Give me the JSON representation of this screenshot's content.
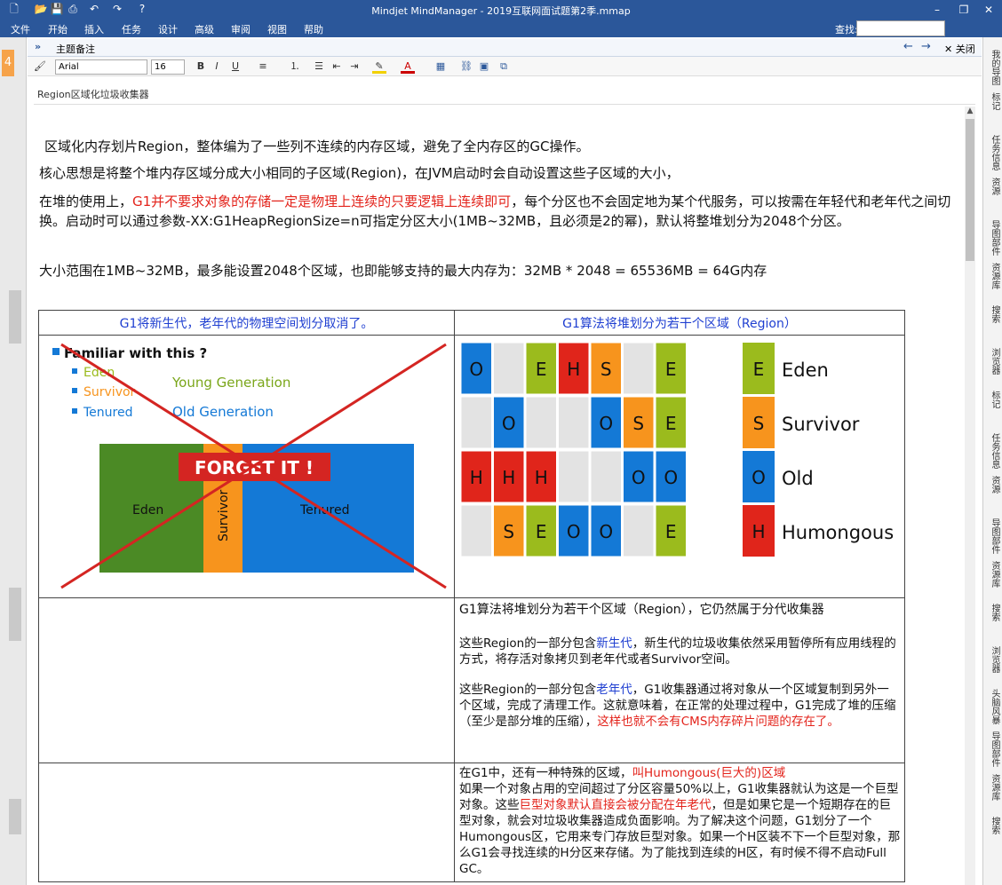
{
  "app": {
    "window_title": "Mindjet MindManager - 2019互联网面试题第2季.mmap",
    "menus": [
      "文件",
      "开始",
      "插入",
      "任务",
      "设计",
      "高级",
      "审阅",
      "视图",
      "帮助"
    ],
    "find_label": "查找:",
    "find_value": ""
  },
  "note_panel": {
    "title": "主题备注",
    "close_label": "✕ 关闭",
    "font_name": "Arial",
    "font_size": "16",
    "bold": "B",
    "italic": "I",
    "underline": "U"
  },
  "right_sidebar": [
    "我的导图",
    "标记",
    "任务信息",
    "资源",
    "导图部件",
    "资源库",
    "搜索",
    "浏览器",
    "标记",
    "任务信息",
    "资源",
    "导图部件",
    "资源库",
    "搜索",
    "浏览器",
    "头脑风暴",
    "导图部件",
    "资源库",
    "搜索"
  ],
  "left_strip_number": "4",
  "topic": "Region区域化垃圾收集器",
  "paragraphs": {
    "p1": "区域化内存划片Region，整体编为了一些列不连续的内存区域，避免了全内存区的GC操作。",
    "p2": "核心思想是将整个堆内存区域分成大小相同的子区域(Region)，在JVM启动时会自动设置这些子区域的大小，",
    "p3_a": "在堆的使用上，",
    "p3_red": "G1并不要求对象的存储一定是物理上连续的只要逻辑上连续即可",
    "p3_b": "，每个分区也不会固定地为某个代服务，可以按需在年轻代和老年代之间切换。启动时可以通过参数-XX:G1HeapRegionSize=n可指定分区大小(1MB~32MB，且必须是2的幂)，默认将整堆划分为2048个分区。",
    "p4": "大小范围在1MB~32MB，最多能设置2048个区域，也即能够支持的最大内存为：32MB * 2048 = 65536MB = 64G内存"
  },
  "table": {
    "header_left": "G1将新生代，老年代的物理空间划分取消了。",
    "header_right": "G1算法将堆划分为若干个区域（Region）",
    "left_image": {
      "heading": "Familiar with this ?",
      "items": [
        "Eden",
        "Survivor",
        "Tenured"
      ],
      "young": "Young Generation",
      "old": "Old Generation",
      "banner": "FORGET IT !",
      "bar_eden": "Eden",
      "bar_survivor": "Survivor",
      "bar_tenured": "Tenured"
    },
    "grid_letters": [
      [
        "O",
        "",
        "E",
        "H",
        "S",
        "",
        "E"
      ],
      [
        "",
        "O",
        "",
        "",
        "O",
        "S",
        "E"
      ],
      [
        "H",
        "H",
        "H",
        "",
        "",
        "O",
        "O"
      ],
      [
        "",
        "S",
        "E",
        "O",
        "O",
        "",
        "E"
      ]
    ],
    "legend": [
      {
        "letter": "E",
        "label": "Eden",
        "color": "#9bbb1d"
      },
      {
        "letter": "S",
        "label": "Survivor",
        "color": "#f7941d"
      },
      {
        "letter": "O",
        "label": "Old",
        "color": "#1479d6"
      },
      {
        "letter": "H",
        "label": "Humongous",
        "color": "#e0251b"
      }
    ],
    "right_row2": {
      "line1": "G1算法将堆划分为若干个区域（Region），它仍然属于分代收集器",
      "p2_a": "这些Region的一部分包含",
      "p2_blue": "新生代",
      "p2_b": "，新生代的垃圾收集依然采用暂停所有应用线程的方式，将存活对象拷贝到老年代或者Survivor空间。",
      "p3_a": "这些Region的一部分包含",
      "p3_blue": "老年代",
      "p3_b": "，G1收集器通过将对象从一个区域复制到另外一个区域，完成了清理工作。这就意味着，在正常的处理过程中，G1完成了堆的压缩（至少是部分堆的压缩），",
      "p3_red": "这样也就不会有CMS内存碎片问题的存在了。"
    },
    "right_row3": {
      "a": "在G1中，还有一种特殊的区域，",
      "a_red": "叫Humongous(巨大的)区域",
      "b": "如果一个对象占用的空间超过了分区容量50%以上，G1收集器就认为这是一个巨型对象。这些",
      "b_red": "巨型对象默认直接会被分配在年老代",
      "c": "，但是如果它是一个短期存在的巨型对象，就会对垃圾收集器造成负面影响。为了解决这个问题，G1划分了一个Humongous区，它用来专门存放巨型对象。如果一个H区装不下一个巨型对象，那么G1会寻找连续的H分区来存储。为了能找到连续的H区，有时候不得不启动Full GC。"
    }
  },
  "colors": {
    "eden": "#9bbb1d",
    "survivor": "#f7941d",
    "old": "#1479d6",
    "humongous": "#e0251b",
    "empty": "#e3e3e3",
    "accent": "#2b579a"
  }
}
